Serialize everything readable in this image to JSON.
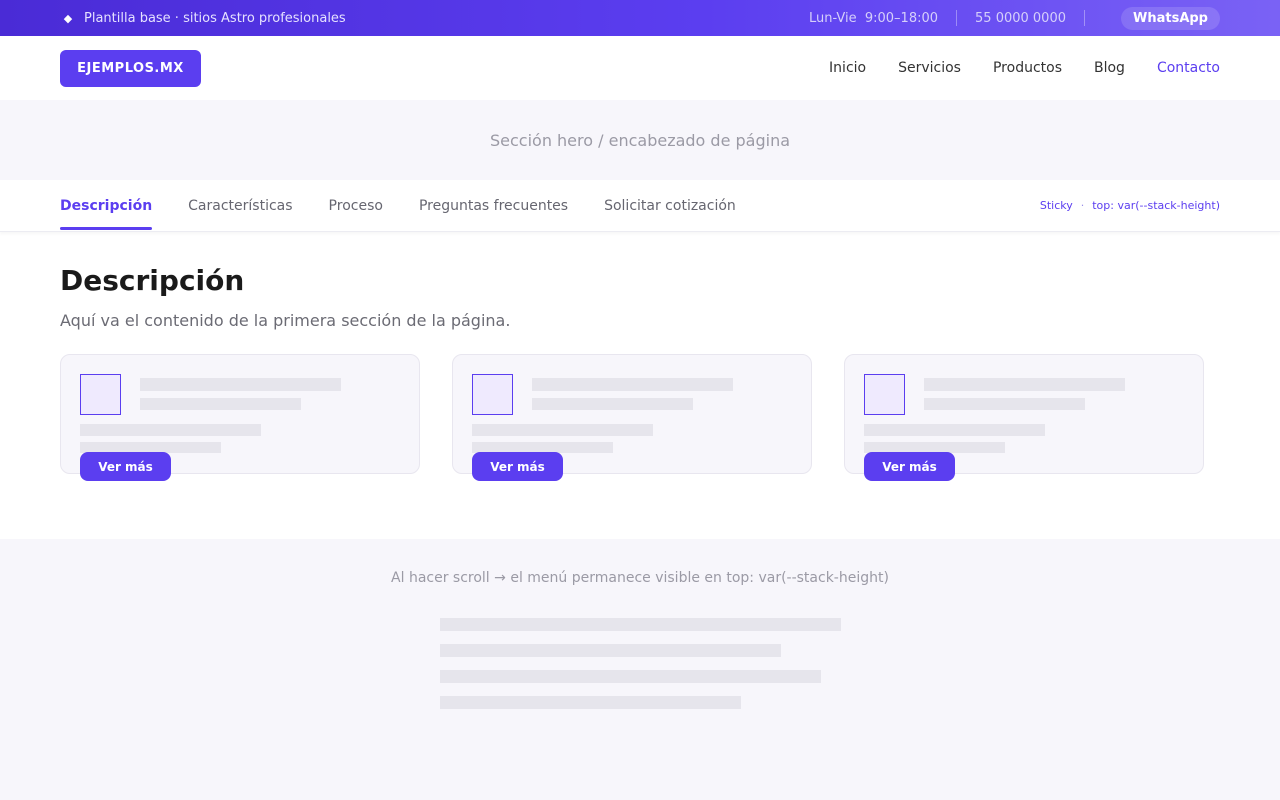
{
  "topbar": {
    "tagline": "Plantilla base · sitios Astro profesionales",
    "hours": "Lun-Vie  9:00–18:00",
    "phone": "55 0000 0000",
    "whatsapp_label": "WhatsApp",
    "diamond_glyph": "◆"
  },
  "header": {
    "logo": "EJEMPLOS.MX",
    "nav": [
      "Inicio",
      "Servicios",
      "Productos",
      "Blog",
      "Contacto"
    ],
    "active_nav": "Contacto"
  },
  "hero": {
    "text": "Sección hero / encabezado de página"
  },
  "tabs": {
    "items": [
      "Descripción",
      "Características",
      "Proceso",
      "Preguntas frecuentes",
      "Solicitar cotización"
    ],
    "active": "Descripción",
    "sticky_label": "Sticky",
    "sticky_sep": "·",
    "sticky_value": "top: var(--stack-height)"
  },
  "content": {
    "title": "Descripción",
    "subtitle": "Aquí va el contenido de la primera sección de la página.",
    "card_button": "Ver más"
  },
  "bottom": {
    "note": "Al hacer scroll → el menú permanece visible en top: var(--stack-height)"
  },
  "colors": {
    "accent": "#5b3ef0",
    "panel": "#f7f6fb",
    "placeholder": "#e6e5ec"
  }
}
